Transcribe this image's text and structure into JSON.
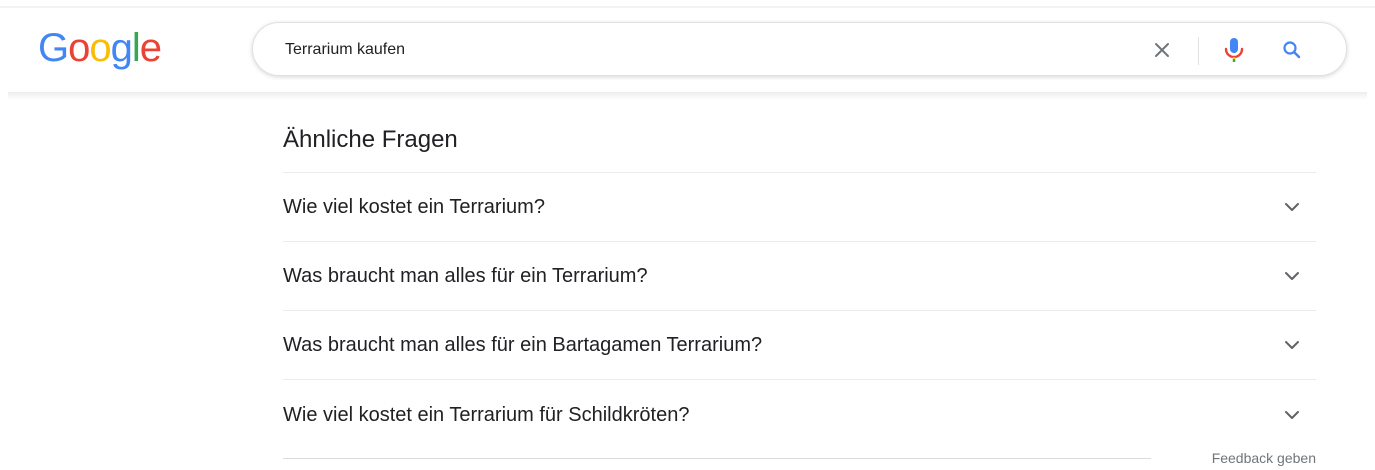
{
  "logo": {
    "letters": [
      "G",
      "o",
      "o",
      "g",
      "l",
      "e"
    ],
    "colors": [
      "#4285F4",
      "#EA4335",
      "#FBBC05",
      "#4285F4",
      "#34A853",
      "#EA4335"
    ]
  },
  "search": {
    "value": "Terrarium kaufen",
    "clear_icon": "close-icon",
    "mic_icon": "microphone-icon",
    "search_icon": "search-icon"
  },
  "paa": {
    "title": "Ähnliche Fragen",
    "questions": [
      "Wie viel kostet ein Terrarium?",
      "Was braucht man alles für ein Terrarium?",
      "Was braucht man alles für ein Bartagamen Terrarium?",
      "Wie viel kostet ein Terrarium für Schildkröten?"
    ],
    "feedback_label": "Feedback geben"
  },
  "colors": {
    "accent_blue": "#1a73e8",
    "text": "#202124",
    "muted": "#70757a"
  }
}
